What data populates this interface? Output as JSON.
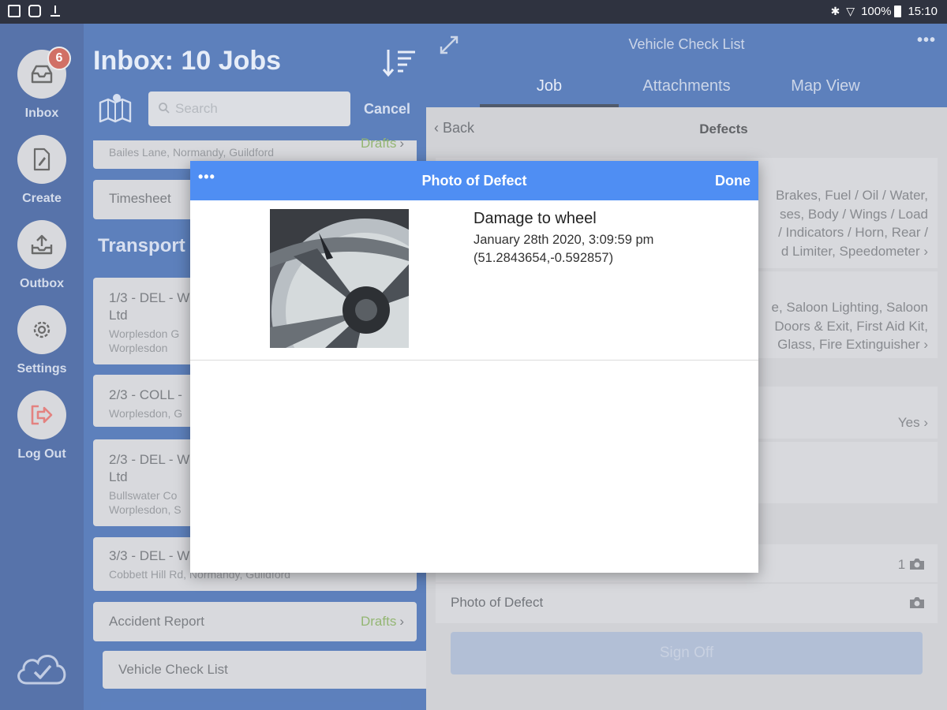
{
  "status_bar": {
    "battery": "100%",
    "time": "15:10"
  },
  "rail": {
    "items": [
      {
        "label": "Inbox",
        "badge": "6",
        "icon": "inbox-tray-icon"
      },
      {
        "label": "Create",
        "icon": "document-edit-icon"
      },
      {
        "label": "Outbox",
        "icon": "upload-tray-icon"
      },
      {
        "label": "Settings",
        "icon": "gear-icon"
      },
      {
        "label": "Log Out",
        "icon": "logout-arrow-icon"
      }
    ],
    "cloud_icon": "cloud-check-icon"
  },
  "inbox": {
    "title": "Inbox: 10 Jobs",
    "search_placeholder": "Search",
    "cancel_label": "Cancel",
    "section_title": "Transport Ltd",
    "partial_card": {
      "address": "Bailes Lane, Normandy, Guildford",
      "status": "Drafts"
    },
    "timesheet_label": "Timesheet",
    "jobs": [
      {
        "line1": "1/3 - DEL - W",
        "line1b": "Ltd",
        "sub1": "Worplesdon G",
        "sub2": "Worplesdon"
      },
      {
        "line1": "2/3 - COLL -",
        "sub1": "Worplesdon, G"
      },
      {
        "line1": "2/3 - DEL - W",
        "line1b": "Ltd",
        "sub1": "Bullswater Co",
        "sub2": "Worplesdon, S"
      },
      {
        "line1": "3/3 - DEL - W",
        "sub1": "Cobbett Hill Rd, Normandy, Guildford"
      }
    ],
    "accident_report": {
      "label": "Accident Report",
      "status": "Drafts"
    },
    "vehicle_check": {
      "label": "Vehicle Check List"
    }
  },
  "right": {
    "title": "Vehicle Check List",
    "more": "•••",
    "tabs": [
      "Job",
      "Attachments",
      "Map View"
    ],
    "back_label": "Back",
    "nav_title": "Defects",
    "card1_lines": [
      "Brakes, Fuel / Oil / Water,",
      "ses, Body / Wings / Load",
      "/ Indicators / Horn, Rear /",
      "d Limiter, Speedometer"
    ],
    "card2_lines": [
      "e, Saloon Lighting, Saloon",
      "Doors & Exit, First Aid Kit,",
      "Glass, Fire Extinguisher"
    ],
    "yes_value": "Yes",
    "photo_count": "1",
    "photo_row_label": "Photo of Defect",
    "signoff_label": "Sign Off"
  },
  "modal": {
    "more": "•••",
    "title": "Photo of Defect",
    "done_label": "Done",
    "caption_title": "Damage to wheel",
    "caption_date": "January 28th 2020, 3:09:59 pm",
    "caption_coords": "(51.2843654,-0.592857)"
  }
}
